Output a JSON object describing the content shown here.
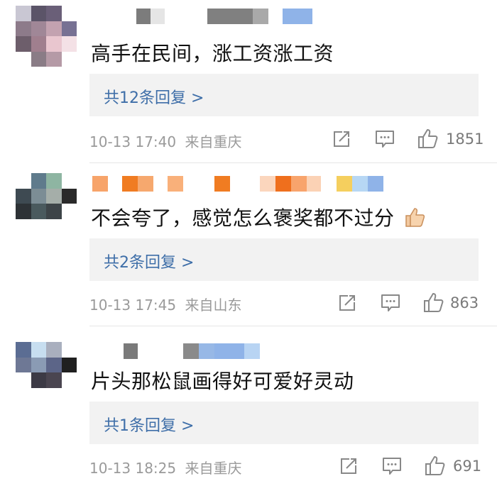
{
  "comments": [
    {
      "text": "高手在民间，涨工资涨工资",
      "replies_label": "共12条回复 >",
      "time": "10-13 17:40",
      "location": "来自重庆",
      "likes": "1851",
      "emoji": ""
    },
    {
      "text": "不会夸了，感觉怎么褒奖都不过分",
      "replies_label": "共2条回复 >",
      "time": "10-13 17:45",
      "location": "来自山东",
      "likes": "863",
      "emoji": "thumbs-up-emoji"
    },
    {
      "text": "片头那松鼠画得好可爱好灵动",
      "replies_label": "共1条回复 >",
      "time": "10-13 18:25",
      "location": "来自重庆",
      "likes": "691",
      "emoji": ""
    }
  ],
  "icons": {
    "share": "share-icon",
    "comment": "comment-icon",
    "like": "thumbs-up-icon"
  },
  "colors": {
    "reply_link": "#3e6ea8",
    "reply_bg": "#f2f2f2",
    "meta_text": "#9a9a9a"
  }
}
